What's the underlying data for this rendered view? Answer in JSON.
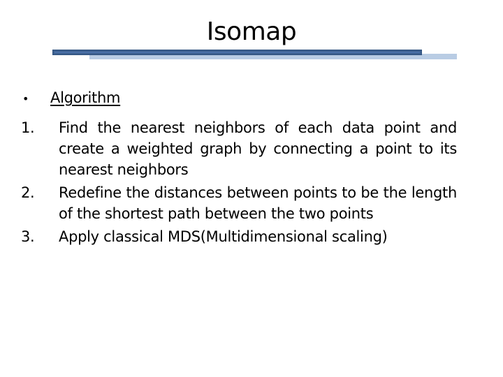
{
  "slide": {
    "title": "Isomap",
    "colors": {
      "bar_dark": "#3c5f8e",
      "bar_dark_inner": "#4a70a8",
      "bar_light": "#b9cce4"
    },
    "bullet": {
      "glyph": "•",
      "label": "Algorithm"
    },
    "steps": [
      {
        "number": "1.",
        "text": "Find the nearest neighbors of each data point and create a weighted graph by connecting a point to its nearest neighbors"
      },
      {
        "number": "2.",
        "text": "Redefine the distances between points to be the length of the shortest path between the two points"
      },
      {
        "number": "3.",
        "text": "Apply classical MDS(Multidimensional scaling)"
      }
    ]
  }
}
